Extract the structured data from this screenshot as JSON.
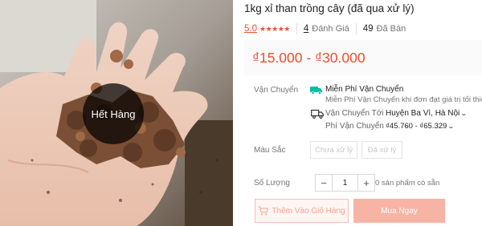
{
  "product": {
    "title": "1kg xỉ than trồng cây (đã qua xử lý)",
    "image_overlay": "Hết Hàng"
  },
  "ratings": {
    "score": "5.0",
    "stars": "★★★★★",
    "reviews_count": "4",
    "reviews_label": "Đánh Giá",
    "sold_count": "49",
    "sold_label": "Đã Bán"
  },
  "price": {
    "range": "₫15.000 - ₫30.000"
  },
  "shipping": {
    "label": "Vận Chuyển",
    "free_title": "Miễn Phí Vận Chuyển",
    "free_note": "Miễn Phí Vận Chuyển khi đơn đạt giá trị tối thiểu",
    "to_label": "Vận Chuyển Tới",
    "to_value": "Huyện Ba Vì, Hà Nội",
    "fee_label": "Phí Vận Chuyển",
    "fee_value": "₫45.760 - ₫65.329"
  },
  "color": {
    "label": "Màu Sắc",
    "options": [
      "Chưa xử lý",
      "Đã xử lý"
    ]
  },
  "quantity": {
    "label": "Số Lượng",
    "minus": "−",
    "value": "1",
    "plus": "+",
    "stock": "0 sản phẩm có sẵn"
  },
  "actions": {
    "add_to_cart": "Thêm Vào Giỏ Hàng",
    "buy_now": "Mua Ngay"
  },
  "colors": {
    "accent": "#ee4d2d",
    "buy_disabled": "#f7b3a4",
    "free_ship_teal": "#00bfa5"
  },
  "icons": [
    "free-shipping-icon",
    "truck-icon",
    "chevron-down-icon",
    "cart-icon",
    "star-icon"
  ]
}
